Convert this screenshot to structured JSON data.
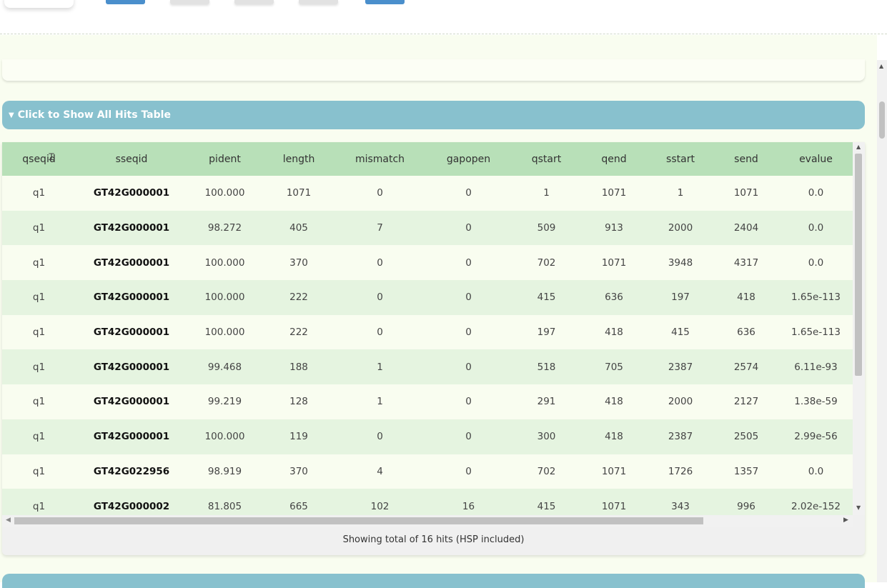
{
  "hits_section": {
    "header_label": "Click to Show All Hits Table",
    "caret_icon": "triangle-down-icon"
  },
  "table": {
    "columns": [
      "qseqid",
      "sseqid",
      "pident",
      "length",
      "mismatch",
      "gapopen",
      "qstart",
      "qend",
      "sstart",
      "send",
      "evalue"
    ],
    "rows": [
      [
        "q1",
        "GT42G000001",
        "100.000",
        "1071",
        "0",
        "0",
        "1",
        "1071",
        "1",
        "1071",
        "0.0"
      ],
      [
        "q1",
        "GT42G000001",
        "98.272",
        "405",
        "7",
        "0",
        "509",
        "913",
        "2000",
        "2404",
        "0.0"
      ],
      [
        "q1",
        "GT42G000001",
        "100.000",
        "370",
        "0",
        "0",
        "702",
        "1071",
        "3948",
        "4317",
        "0.0"
      ],
      [
        "q1",
        "GT42G000001",
        "100.000",
        "222",
        "0",
        "0",
        "415",
        "636",
        "197",
        "418",
        "1.65e-113"
      ],
      [
        "q1",
        "GT42G000001",
        "100.000",
        "222",
        "0",
        "0",
        "197",
        "418",
        "415",
        "636",
        "1.65e-113"
      ],
      [
        "q1",
        "GT42G000001",
        "99.468",
        "188",
        "1",
        "0",
        "518",
        "705",
        "2387",
        "2574",
        "6.11e-93"
      ],
      [
        "q1",
        "GT42G000001",
        "99.219",
        "128",
        "1",
        "0",
        "291",
        "418",
        "2000",
        "2127",
        "1.38e-59"
      ],
      [
        "q1",
        "GT42G000001",
        "100.000",
        "119",
        "0",
        "0",
        "300",
        "418",
        "2387",
        "2505",
        "2.99e-56"
      ],
      [
        "q1",
        "GT42G022956",
        "98.919",
        "370",
        "4",
        "0",
        "702",
        "1071",
        "1726",
        "1357",
        "0.0"
      ],
      [
        "q1",
        "GT42G000002",
        "81.805",
        "665",
        "102",
        "16",
        "415",
        "1071",
        "343",
        "996",
        "2.02e-152"
      ]
    ],
    "footer": "Showing total of 16 hits (HSP included)"
  },
  "colors": {
    "header_bar": "#88c1ce",
    "table_head": "#b8e0b8",
    "row_odd": "#f9fdf0",
    "row_even": "#e5f4e0",
    "toolbar_blue": "#4a8fcc"
  }
}
